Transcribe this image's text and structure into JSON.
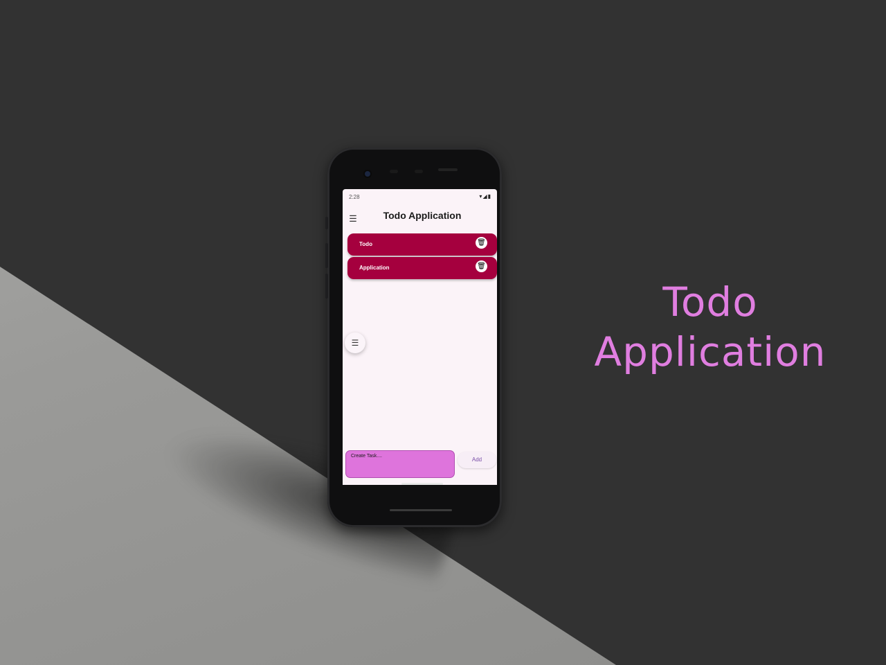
{
  "hero": {
    "title_line1": "Todo",
    "title_line2": "Application",
    "color": "#e07ee0"
  },
  "status_bar": {
    "time": "2:28",
    "icons": "▾◢▮"
  },
  "app_bar": {
    "menu_icon": "☰",
    "title": "Todo Application"
  },
  "todos": [
    {
      "label": "Todo",
      "delete_icon": "🗑"
    },
    {
      "label": "Application",
      "delete_icon": "🗑"
    }
  ],
  "fab": {
    "icon": "☰"
  },
  "task_input": {
    "placeholder": "Create Task...."
  },
  "add_button": {
    "label": "Add"
  },
  "colors": {
    "background": "#323232",
    "item_bg": "#a5003e",
    "input_bg": "#de74dc",
    "screen_bg": "#fbf3f8"
  }
}
